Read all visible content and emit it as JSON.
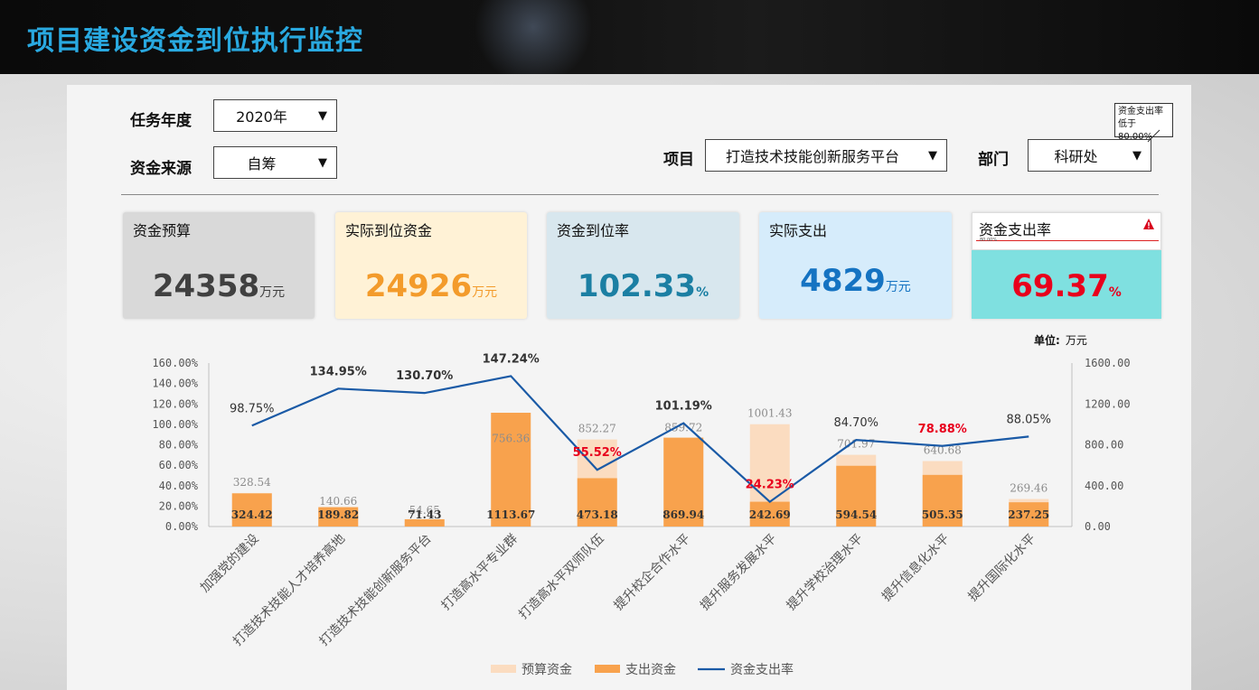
{
  "header": {
    "title": "项目建设资金到位执行监控"
  },
  "filters": {
    "year": {
      "label": "任务年度",
      "value": "2020年"
    },
    "source": {
      "label": "资金来源",
      "value": "自筹"
    },
    "project": {
      "label": "项目",
      "value": "打造技术技能创新服务平台"
    },
    "department": {
      "label": "部门",
      "value": "科研处"
    },
    "arrow": "▼"
  },
  "cards": {
    "budget": {
      "title": "资金预算",
      "value": "24358",
      "unit": "万元",
      "bg": "#d9d9d9",
      "color": "#404040"
    },
    "received": {
      "title": "实际到位资金",
      "value": "24926",
      "unit": "万元",
      "bg": "#fff2d6",
      "color": "#f39b2b"
    },
    "received_rate": {
      "title": "资金到位率",
      "value": "102.33",
      "unit": "%",
      "bg": "#d8e7ee",
      "color": "#1b7fa3"
    },
    "spent": {
      "title": "实际支出",
      "value": "4829",
      "unit": "万元",
      "bg": "#d6ecfb",
      "color": "#1573c2"
    },
    "spend_rate": {
      "title": "资金支出率",
      "value": "69.37",
      "unit": "%",
      "bg": "#7fe0e0",
      "color": "#e8001c",
      "threshold_text": "80.00%",
      "warning_icon": "warning-triangle-icon"
    }
  },
  "callout": {
    "line1": "资金支出率",
    "line2": "低于80.00%"
  },
  "unit_label": {
    "label": "单位:",
    "value": "万元"
  },
  "chart_data": {
    "type": "bar",
    "categories": [
      "加强党的建设",
      "打造技术技能人才培养高地",
      "打造技术技能创新服务平台",
      "打造高水平专业群",
      "打造高水平双师队伍",
      "提升校企合作水平",
      "提升服务发展水平",
      "提升学校治理水平",
      "提升信息化水平",
      "提升国际化水平"
    ],
    "series": [
      {
        "name": "预算资金",
        "kind": "bar",
        "axis": "right",
        "color": "#fbdcc0",
        "values": [
          328.54,
          140.66,
          54.65,
          756.36,
          852.27,
          859.72,
          1001.43,
          701.97,
          640.68,
          269.46
        ]
      },
      {
        "name": "支出资金",
        "kind": "bar",
        "axis": "right",
        "color": "#f8a24d",
        "values": [
          324.42,
          189.82,
          71.43,
          1113.67,
          473.18,
          869.94,
          242.69,
          594.54,
          505.35,
          237.25
        ]
      },
      {
        "name": "资金支出率",
        "kind": "line",
        "axis": "left",
        "color": "#1a5aa6",
        "values": [
          98.75,
          134.95,
          130.7,
          147.24,
          55.52,
          101.19,
          24.23,
          84.7,
          78.88,
          88.05
        ]
      }
    ],
    "rate_labels": [
      "98.75%",
      "134.95%",
      "130.70%",
      "147.24%",
      "55.52%",
      "101.19%",
      "24.23%",
      "84.70%",
      "78.88%",
      "88.05%"
    ],
    "budget_labels": [
      "328.54",
      "140.66",
      "54.65",
      "756.36",
      "852.27",
      "859.72",
      "1001.43",
      "701.97",
      "640.68",
      "269.46"
    ],
    "spent_labels": [
      "324.42",
      "189.82",
      "71.43",
      "1113.67",
      "473.18",
      "869.94",
      "242.69",
      "594.54",
      "505.35",
      "237.25"
    ],
    "rate_label_colors": [
      "#333333",
      "#333333",
      "#333333",
      "#333333",
      "#e8001c",
      "#333333",
      "#e8001c",
      "#333333",
      "#e8001c",
      "#333333"
    ],
    "left_axis": {
      "ticks": [
        "0.00%",
        "20.00%",
        "40.00%",
        "60.00%",
        "80.00%",
        "100.00%",
        "120.00%",
        "140.00%",
        "160.00%"
      ],
      "min": 0,
      "max": 160
    },
    "right_axis": {
      "ticks": [
        "0.00",
        "400.00",
        "800.00",
        "1200.00",
        "1600.00"
      ],
      "min": 0,
      "max": 1600
    },
    "grid": false,
    "legend_position": "bottom"
  }
}
